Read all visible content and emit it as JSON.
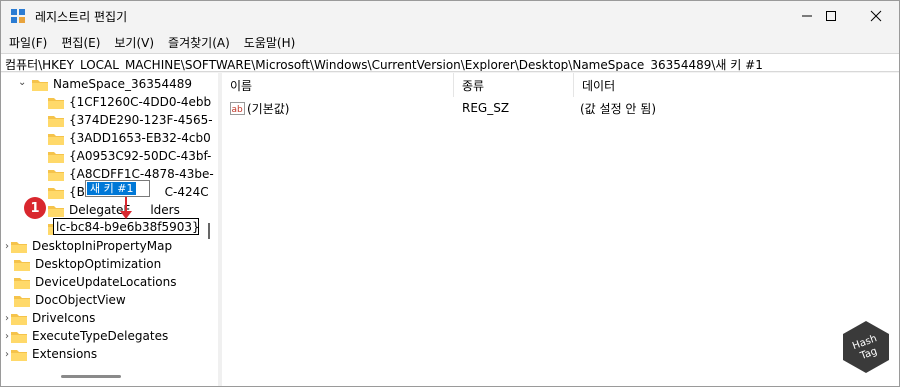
{
  "window": {
    "title": "레지스트리 편집기"
  },
  "controls": {
    "minimize": "—",
    "maximize": "☐",
    "close": "✕"
  },
  "menu": [
    "파일(F)",
    "편집(E)",
    "보기(V)",
    "즐겨찾기(A)",
    "도움말(H)"
  ],
  "address": "컴퓨터\\HKEY_LOCAL_MACHINE\\SOFTWARE\\Microsoft\\Windows\\CurrentVersion\\Explorer\\Desktop\\NameSpace_36354489\\새 키 #1",
  "tree": {
    "parent": "NameSpace_36354489",
    "children": [
      "{1CF1260C-4DD0-4ebb",
      "{374DE290-123F-4565-",
      "{3ADD1653-EB32-4cb0",
      "{A0953C92-50DC-43bf-",
      "{A8CDFF1C-4878-43be-",
      "{B4BF",
      "C-424C",
      "DelegateF",
      "lders"
    ],
    "rename_value": "lc-bc84-b9e6b38f5903}",
    "tooltip": "새 키 #1",
    "siblings": [
      "DesktopIniPropertyMap",
      "DesktopOptimization",
      "DeviceUpdateLocations",
      "DocObjectView",
      "DriveIcons",
      "ExecuteTypeDelegates",
      "Extensions"
    ],
    "badge": "1"
  },
  "list": {
    "headers": [
      "이름",
      "종류",
      "데이터"
    ],
    "rows": [
      {
        "icon": "ab",
        "name": "(기본값)",
        "type": "REG_SZ",
        "data": "(값 설정 안 됨)"
      }
    ]
  },
  "watermark": {
    "line1": "Hash",
    "line2": "Tag"
  }
}
